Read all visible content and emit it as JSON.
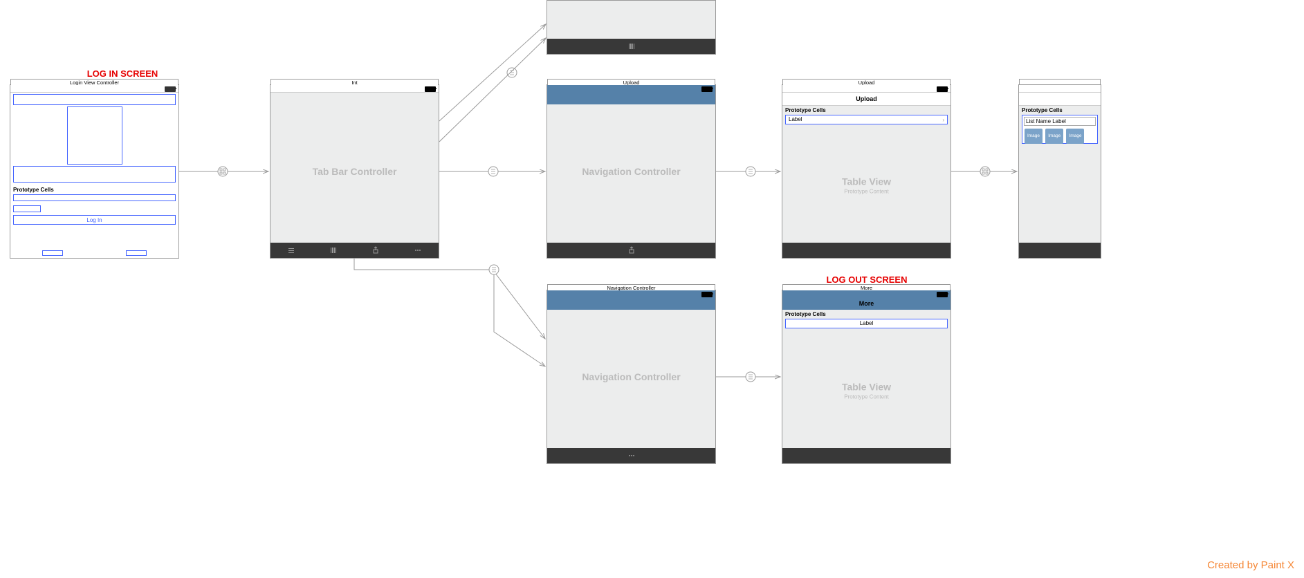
{
  "annotations": {
    "login": "LOG IN SCREEN",
    "logout": "LOG OUT SCREEN"
  },
  "watermark": "Created by Paint X",
  "screens": {
    "login": {
      "title": "Login View Controller",
      "proto": "Prototype Cells",
      "btn": "Log In"
    },
    "tabbar": {
      "title": "Int",
      "label": "Tab Bar Controller",
      "tabs": [
        "My list",
        "Scanner",
        "Upload",
        "More"
      ]
    },
    "nav1": {
      "title": "Upload",
      "label": "Navigation Controller"
    },
    "table1": {
      "title": "Upload",
      "nav": "Upload",
      "proto": "Prototype Cells",
      "cell": "Label",
      "label": "Table View",
      "sub": "Prototype Content"
    },
    "nav2": {
      "title": "Navigation Controller",
      "label": "Navigation Controller"
    },
    "table2": {
      "title": "More",
      "nav": "More",
      "proto": "Prototype Cells",
      "cell": "Label",
      "label": "Table View",
      "sub": "Prototype Content"
    },
    "collection": {
      "proto": "Prototype Cells",
      "cell": "List Name Label",
      "img": "Image"
    }
  }
}
